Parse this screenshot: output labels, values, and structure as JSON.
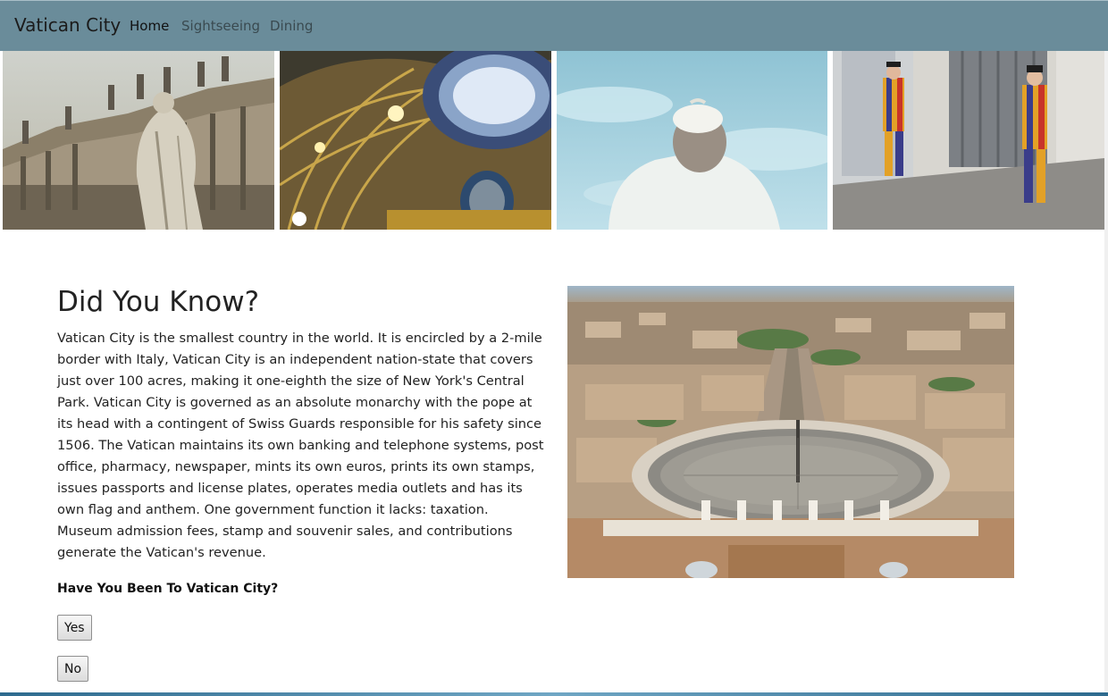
{
  "navbar": {
    "brand": "Vatican City",
    "links": [
      {
        "label": "Home",
        "active": true
      },
      {
        "label": "Sightseeing",
        "active": false
      },
      {
        "label": "Dining",
        "active": false
      }
    ]
  },
  "photo_strip": [
    {
      "subject": "St. Peter's facade statues"
    },
    {
      "subject": "Basilica dome interior"
    },
    {
      "subject": "Pope seen from behind against sky"
    },
    {
      "subject": "Swiss Guards at gate"
    }
  ],
  "article": {
    "heading": "Did You Know?",
    "body": "Vatican City is the smallest country in the world. It is encircled by a 2-mile border with Italy, Vatican City is an independent nation-state that covers just over 100 acres, making it one-eighth the size of New York's Central Park. Vatican City is governed as an absolute monarchy with the pope at its head with a contingent of Swiss Guards responsible for his safety since 1506. The Vatican maintains its own banking and telephone systems, post office, pharmacy, newspaper, mints its own euros, prints its own stamps, issues passports and license plates, operates media outlets and has its own flag and anthem. One government function it lacks: taxation. Museum admission fees, stamp and souvenir sales, and contributions generate the Vatican's revenue.",
    "question": "Have You Been To Vatican City?",
    "yes_label": "Yes",
    "no_label": "No"
  },
  "aerial_image": {
    "subject": "Aerial view of St. Peter's Square"
  },
  "colors": {
    "navbar_bg": "#6a8c9a",
    "text": "#222222",
    "link": "#3a4a50"
  }
}
